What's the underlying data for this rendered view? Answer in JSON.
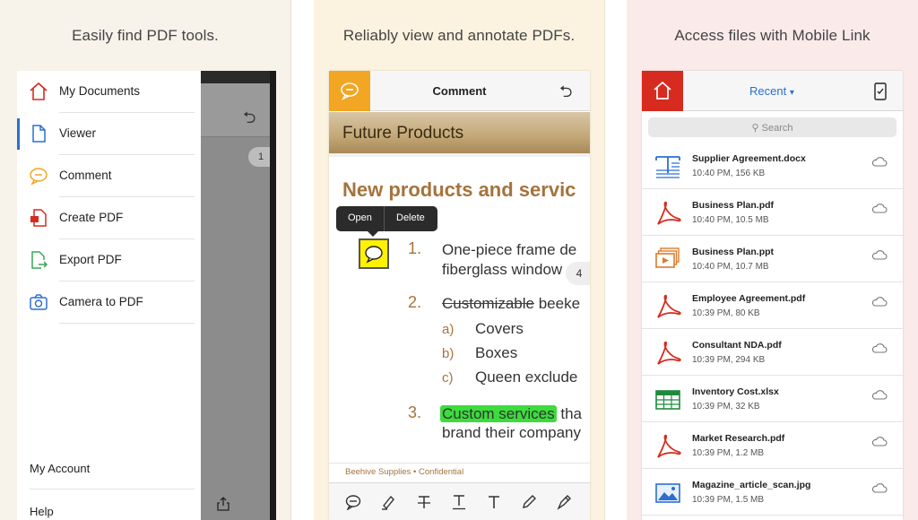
{
  "panel1": {
    "caption": "Easily find PDF tools.",
    "menu": [
      {
        "label": "My Documents",
        "icon": "home-outline-icon"
      },
      {
        "label": "Viewer",
        "icon": "document-icon"
      },
      {
        "label": "Comment",
        "icon": "speech-bubble-icon"
      },
      {
        "label": "Create PDF",
        "icon": "create-pdf-icon"
      },
      {
        "label": "Export PDF",
        "icon": "export-pdf-icon"
      },
      {
        "label": "Camera to PDF",
        "icon": "camera-icon"
      }
    ],
    "account": "My Account",
    "help": "Help",
    "page_badge": "1",
    "colors": {
      "active_indicator": "#2c6fd1",
      "home_icon": "#d62b1e"
    }
  },
  "panel2": {
    "caption": "Reliably view and annotate PDFs.",
    "title": "Comment",
    "banner": "Future Products",
    "heading": "New products and servic",
    "popup": {
      "open": "Open",
      "delete": "Delete"
    },
    "list": [
      {
        "num": "1.",
        "lines": [
          "One-piece frame de",
          "fiberglass window sc"
        ]
      },
      {
        "num": "2.",
        "strike": "Customizable",
        "rest": " beeke"
      },
      {
        "num": "3.",
        "highlight": "Custom services",
        "rest": " tha",
        "line2": "brand their company"
      }
    ],
    "sublist": [
      {
        "letter": "a)",
        "text": "Covers"
      },
      {
        "letter": "b)",
        "text": "Boxes"
      },
      {
        "letter": "c)",
        "text": "Queen exclude"
      }
    ],
    "page_badge": "4",
    "footer": "Beehive Supplies  •  Confidential",
    "toolbar": [
      "comment-tool-icon",
      "highlighter-icon",
      "strikethrough-icon",
      "underline-icon",
      "text-icon",
      "pencil-icon",
      "pen-icon"
    ],
    "colors": {
      "comment_tile": "#f2a623",
      "heading": "#a5733d",
      "highlight": "#3ddc3d",
      "strike": "#d0021b",
      "sticky": "#fff200"
    }
  },
  "panel3": {
    "caption": "Access files with Mobile Link",
    "recent_label": "Recent",
    "search_placeholder": "Search",
    "files": [
      {
        "name": "Supplier Agreement.docx",
        "meta": "10:40 PM, 156 KB",
        "type": "word"
      },
      {
        "name": "Business Plan.pdf",
        "meta": "10:40 PM, 10.5 MB",
        "type": "pdf"
      },
      {
        "name": "Business Plan.ppt",
        "meta": "10:40 PM, 10.7 MB",
        "type": "ppt"
      },
      {
        "name": "Employee Agreement.pdf",
        "meta": "10:39 PM, 80 KB",
        "type": "pdf"
      },
      {
        "name": "Consultant NDA.pdf",
        "meta": "10:39 PM, 294 KB",
        "type": "pdf"
      },
      {
        "name": "Inventory Cost.xlsx",
        "meta": "10:39 PM, 32 KB",
        "type": "xlsx"
      },
      {
        "name": "Market Research.pdf",
        "meta": "10:39 PM, 1.2 MB",
        "type": "pdf"
      },
      {
        "name": "Magazine_article_scan.jpg",
        "meta": "10:39 PM, 1.5 MB",
        "type": "jpg"
      }
    ],
    "colors": {
      "home_tile": "#d62b1e",
      "recent": "#2c6fd1",
      "pdf": "#d62b1e"
    }
  }
}
